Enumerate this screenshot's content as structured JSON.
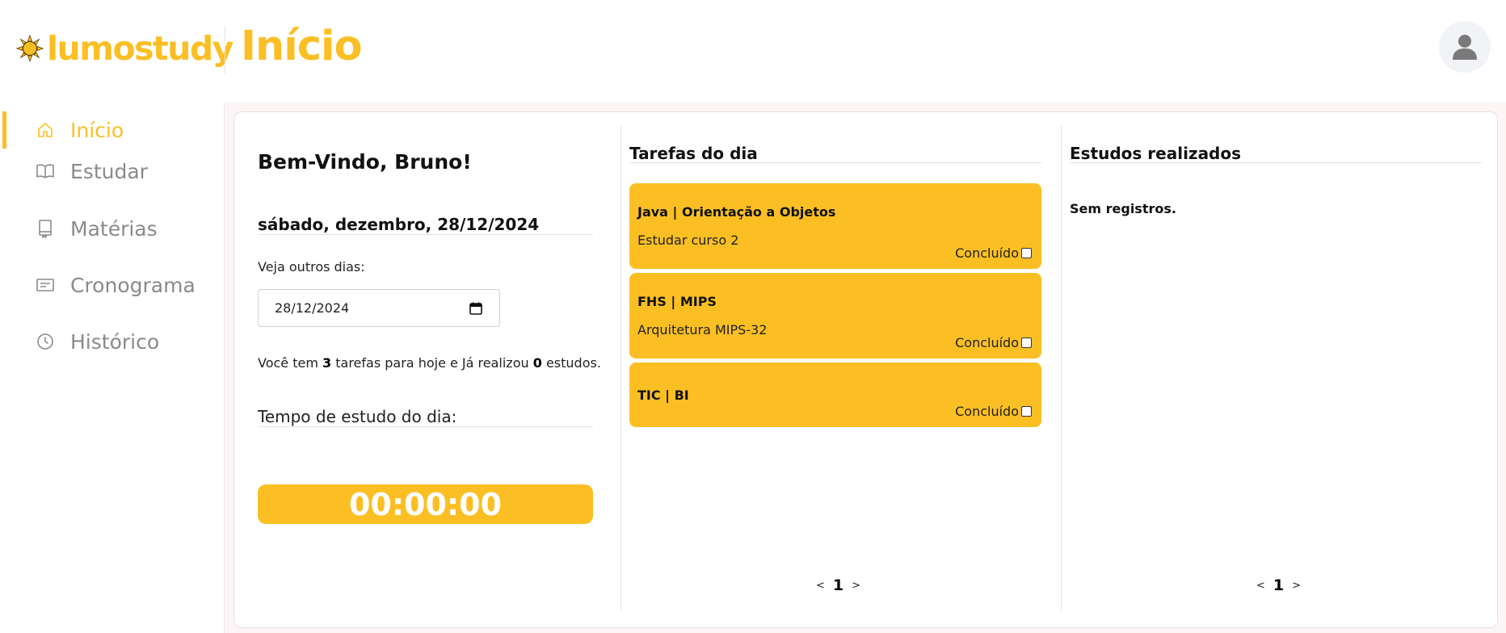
{
  "app": {
    "logo_text": "lumostudy",
    "page_title": "Início"
  },
  "sidebar": {
    "items": [
      {
        "label": "Início",
        "icon": "home-icon",
        "active": true
      },
      {
        "label": "Estudar",
        "icon": "book-open-icon",
        "active": false
      },
      {
        "label": "Matérias",
        "icon": "notebook-icon",
        "active": false
      },
      {
        "label": "Cronograma",
        "icon": "schedule-icon",
        "active": false
      },
      {
        "label": "Histórico",
        "icon": "clock-icon",
        "active": false
      }
    ]
  },
  "welcome": {
    "greeting": "Bem-Vindo, Bruno!",
    "date_title": "sábado, dezembro, 28/12/2024",
    "other_days_label": "Veja outros dias:",
    "date_value": "28/12/2024",
    "summary": {
      "prefix": "Você tem",
      "tasks_count": "3",
      "middle": "tarefas para hoje e Já realizou",
      "studies_count": "0",
      "suffix": "estudos."
    },
    "study_time_label": "Tempo de estudo do dia:",
    "timer": "00:00:00"
  },
  "tasks": {
    "heading": "Tarefas do dia",
    "done_label": "Concluído",
    "items": [
      {
        "title": "Java | Orientação a Objetos",
        "description": "Estudar curso 2",
        "done": false
      },
      {
        "title": "FHS | MIPS",
        "description": "Arquitetura MIPS-32",
        "done": false
      },
      {
        "title": "TIC | BI",
        "description": "",
        "done": false
      }
    ],
    "pager": {
      "prev": "<",
      "page": "1",
      "next": ">"
    }
  },
  "studies": {
    "heading": "Estudos realizados",
    "empty_message": "Sem registros.",
    "pager": {
      "prev": "<",
      "page": "1",
      "next": ">"
    }
  },
  "colors": {
    "accent": "#fbbf24",
    "muted": "#8a8a8a",
    "background": "#fbf5f6"
  }
}
